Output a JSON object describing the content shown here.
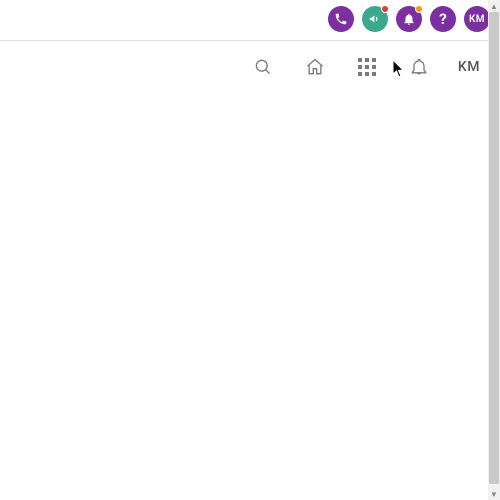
{
  "top_badges": {
    "phone": {
      "name": "phone-icon"
    },
    "announcement": {
      "name": "megaphone-icon",
      "dot_color": "#e53935"
    },
    "alerts": {
      "name": "bell-icon",
      "dot_color": "#ff9800"
    },
    "help": {
      "name": "question-icon",
      "glyph": "?"
    },
    "avatar": {
      "initials": "KM"
    }
  },
  "toolbar": {
    "search": {
      "name": "search-icon"
    },
    "home": {
      "name": "home-icon"
    },
    "apps": {
      "name": "apps-grid-icon"
    },
    "notify": {
      "name": "bell-outline-icon"
    },
    "user": {
      "initials": "KM"
    }
  },
  "colors": {
    "purple": "#7b2fa0",
    "teal": "#3aa98c"
  }
}
